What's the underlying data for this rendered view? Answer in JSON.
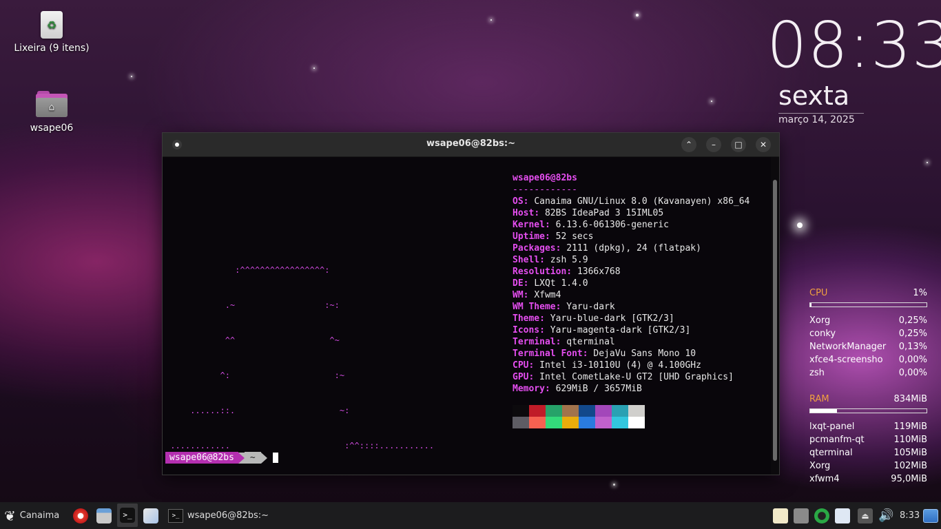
{
  "desktop": {
    "icons": [
      {
        "label": "Lixeira (9 itens)",
        "icon": "trash-icon"
      },
      {
        "label": "wsape06",
        "icon": "home-folder-icon"
      }
    ]
  },
  "clock": {
    "time": "08:33",
    "day": "sexta",
    "date": "março 14, 2025"
  },
  "terminal": {
    "title": "wsape06@82bs:~",
    "ascii_art": [
      "              :^^^^^^^^^^^^^^^^^:",
      "            .~                  :~:",
      "            ^^                   ^~",
      "           ^:                     :~",
      "     ......::.                     ~:",
      " ............                       :^^::::..........."
    ],
    "neofetch": {
      "header": "wsape06@82bs",
      "separator": "------------",
      "rows": [
        {
          "key": "OS",
          "value": "Canaima GNU/Linux 8.0 (Kavanayen) x86_64"
        },
        {
          "key": "Host",
          "value": "82BS IdeaPad 3 15IML05"
        },
        {
          "key": "Kernel",
          "value": "6.13.6-061306-generic"
        },
        {
          "key": "Uptime",
          "value": "52 secs"
        },
        {
          "key": "Packages",
          "value": "2111 (dpkg), 24 (flatpak)"
        },
        {
          "key": "Shell",
          "value": "zsh 5.9"
        },
        {
          "key": "Resolution",
          "value": "1366x768"
        },
        {
          "key": "DE",
          "value": "LXQt 1.4.0"
        },
        {
          "key": "WM",
          "value": "Xfwm4"
        },
        {
          "key": "WM Theme",
          "value": "Yaru-dark"
        },
        {
          "key": "Theme",
          "value": "Yaru-blue-dark [GTK2/3]"
        },
        {
          "key": "Icons",
          "value": "Yaru-magenta-dark [GTK2/3]"
        },
        {
          "key": "Terminal",
          "value": "qterminal"
        },
        {
          "key": "Terminal Font",
          "value": "DejaVu Sans Mono 10"
        },
        {
          "key": "CPU",
          "value": "Intel i3-10110U (4) @ 4.100GHz"
        },
        {
          "key": "GPU",
          "value": "Intel CometLake-U GT2 [UHD Graphics]"
        },
        {
          "key": "Memory",
          "value": "629MiB / 3657MiB"
        }
      ],
      "palette_dark": [
        "#0c0a0d",
        "#c01c28",
        "#26a269",
        "#a2734c",
        "#12488b",
        "#a347ba",
        "#2aa1b3",
        "#d0cfcc"
      ],
      "palette_bright": [
        "#5e5c64",
        "#f66151",
        "#33da7a",
        "#e9ad0c",
        "#2a7bde",
        "#c061cb",
        "#33c7de",
        "#ffffff"
      ]
    },
    "prompt": {
      "user_host": "wsape06@82bs",
      "dir": "~"
    }
  },
  "conky": {
    "cpu": {
      "label": "CPU",
      "value": "1%",
      "usage_fraction": 0.01,
      "processes": [
        {
          "name": "Xorg",
          "value": "0,25%"
        },
        {
          "name": "conky",
          "value": "0,25%"
        },
        {
          "name": "NetworkManager",
          "value": "0,13%"
        },
        {
          "name": "xfce4-screensho",
          "value": "0,00%"
        },
        {
          "name": "zsh",
          "value": "0,00%"
        }
      ]
    },
    "ram": {
      "label": "RAM",
      "value": "834MiB",
      "usage_fraction": 0.23,
      "processes": [
        {
          "name": "lxqt-panel",
          "value": "119MiB"
        },
        {
          "name": "pcmanfm-qt",
          "value": "110MiB"
        },
        {
          "name": "qterminal",
          "value": "105MiB"
        },
        {
          "name": "Xorg",
          "value": "102MiB"
        },
        {
          "name": "xfwm4",
          "value": "95,0MiB"
        }
      ]
    }
  },
  "taskbar": {
    "menu_label": "Canaima",
    "quicklaunch": [
      "browser-icon",
      "file-manager-icon",
      "terminal-icon",
      "text-editor-icon"
    ],
    "task": {
      "label": "wsape06@82bs:~",
      "icon": "terminal-icon"
    },
    "tray": [
      "clipboard-icon",
      "network-icon",
      "update-icon",
      "bluetooth-icon",
      "eject-icon",
      "volume-icon"
    ],
    "clock": "8:33",
    "show_desktop": "show-desktop-icon"
  }
}
